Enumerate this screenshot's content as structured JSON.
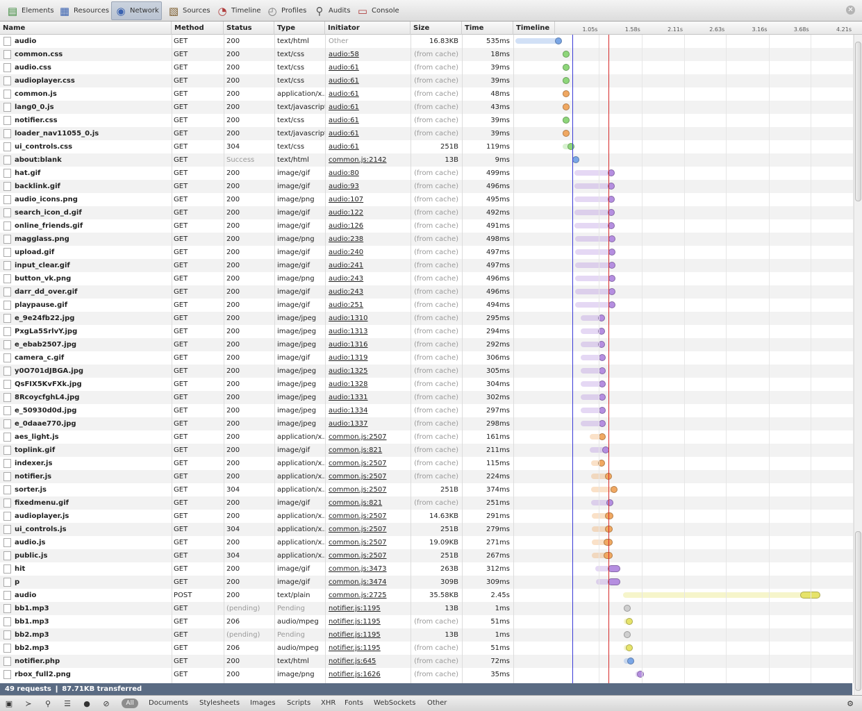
{
  "toolbar": {
    "tabs": [
      {
        "label": "Elements",
        "icon": "elements-icon"
      },
      {
        "label": "Resources",
        "icon": "resources-icon"
      },
      {
        "label": "Network",
        "icon": "network-icon",
        "selected": true
      },
      {
        "label": "Sources",
        "icon": "sources-icon"
      },
      {
        "label": "Timeline",
        "icon": "timeline-icon"
      },
      {
        "label": "Profiles",
        "icon": "profiles-icon"
      },
      {
        "label": "Audits",
        "icon": "audits-icon"
      },
      {
        "label": "Console",
        "icon": "console-icon"
      }
    ]
  },
  "columns": {
    "name": "Name",
    "method": "Method",
    "status": "Status",
    "type": "Type",
    "initiator": "Initiator",
    "size": "Size",
    "time": "Time",
    "timeline": "Timeline"
  },
  "timeline_ticks": [
    "1.05s",
    "1.58s",
    "2.11s",
    "2.63s",
    "3.16s",
    "3.68s",
    "4.21s"
  ],
  "timeline_scale_s": [
    0,
    4.21
  ],
  "markers": {
    "dom_content_loaded_s": 0.72,
    "load_s": 1.17,
    "dom_color": "#3a3ad6",
    "load_color": "#d62a2a"
  },
  "colors": {
    "html": "#7aa6e6",
    "css": "#8ed67a",
    "script": "#f0a862",
    "image": "#b58ee0",
    "other": "#e6e36a",
    "pending": "#cfcfcf"
  },
  "requests": [
    {
      "name": "audio",
      "method": "GET",
      "status": "200",
      "type": "text/html",
      "initiator": "Other",
      "size": "16.83KB",
      "time": "535ms",
      "kind": "html",
      "start": 0.01,
      "wait": 0.5,
      "end": 0.58
    },
    {
      "name": "common.css",
      "method": "GET",
      "status": "200",
      "type": "text/css",
      "initiator": "audio:58",
      "size": "(from cache)",
      "time": "18ms",
      "kind": "css",
      "start": 0.6,
      "wait": 0.6,
      "end": 0.63
    },
    {
      "name": "audio.css",
      "method": "GET",
      "status": "200",
      "type": "text/css",
      "initiator": "audio:61",
      "size": "(from cache)",
      "time": "39ms",
      "kind": "css",
      "start": 0.6,
      "wait": 0.6,
      "end": 0.64
    },
    {
      "name": "audioplayer.css",
      "method": "GET",
      "status": "200",
      "type": "text/css",
      "initiator": "audio:61",
      "size": "(from cache)",
      "time": "39ms",
      "kind": "css",
      "start": 0.6,
      "wait": 0.6,
      "end": 0.64
    },
    {
      "name": "common.js",
      "method": "GET",
      "status": "200",
      "type": "application/x...",
      "initiator": "audio:61",
      "size": "(from cache)",
      "time": "48ms",
      "kind": "script",
      "start": 0.6,
      "wait": 0.6,
      "end": 0.64
    },
    {
      "name": "lang0_0.js",
      "method": "GET",
      "status": "200",
      "type": "text/javascript",
      "initiator": "audio:61",
      "size": "(from cache)",
      "time": "43ms",
      "kind": "script",
      "start": 0.6,
      "wait": 0.6,
      "end": 0.64
    },
    {
      "name": "notifier.css",
      "method": "GET",
      "status": "200",
      "type": "text/css",
      "initiator": "audio:61",
      "size": "(from cache)",
      "time": "39ms",
      "kind": "css",
      "start": 0.6,
      "wait": 0.6,
      "end": 0.64
    },
    {
      "name": "loader_nav11055_0.js",
      "method": "GET",
      "status": "200",
      "type": "text/javascript",
      "initiator": "audio:61",
      "size": "(from cache)",
      "time": "39ms",
      "kind": "script",
      "start": 0.6,
      "wait": 0.6,
      "end": 0.64
    },
    {
      "name": "ui_controls.css",
      "method": "GET",
      "status": "304",
      "type": "text/css",
      "initiator": "audio:61",
      "size": "251B",
      "time": "119ms",
      "kind": "css",
      "start": 0.6,
      "wait": 0.66,
      "end": 0.7
    },
    {
      "name": "about:blank",
      "method": "GET",
      "status": "Success",
      "type": "text/html",
      "initiator": "common.js:2142",
      "size": "13B",
      "time": "9ms",
      "kind": "html",
      "start": 0.72,
      "wait": 0.72,
      "end": 0.74
    },
    {
      "name": "hat.gif",
      "method": "GET",
      "status": "200",
      "type": "image/gif",
      "initiator": "audio:80",
      "size": "(from cache)",
      "time": "499ms",
      "kind": "image",
      "start": 0.74,
      "wait": 1.16,
      "end": 1.21
    },
    {
      "name": "backlink.gif",
      "method": "GET",
      "status": "200",
      "type": "image/gif",
      "initiator": "audio:93",
      "size": "(from cache)",
      "time": "496ms",
      "kind": "image",
      "start": 0.74,
      "wait": 1.16,
      "end": 1.21
    },
    {
      "name": "audio_icons.png",
      "method": "GET",
      "status": "200",
      "type": "image/png",
      "initiator": "audio:107",
      "size": "(from cache)",
      "time": "495ms",
      "kind": "image",
      "start": 0.74,
      "wait": 1.16,
      "end": 1.21
    },
    {
      "name": "search_icon_d.gif",
      "method": "GET",
      "status": "200",
      "type": "image/gif",
      "initiator": "audio:122",
      "size": "(from cache)",
      "time": "492ms",
      "kind": "image",
      "start": 0.74,
      "wait": 1.16,
      "end": 1.21
    },
    {
      "name": "online_friends.gif",
      "method": "GET",
      "status": "200",
      "type": "image/gif",
      "initiator": "audio:126",
      "size": "(from cache)",
      "time": "491ms",
      "kind": "image",
      "start": 0.74,
      "wait": 1.16,
      "end": 1.21
    },
    {
      "name": "magglass.png",
      "method": "GET",
      "status": "200",
      "type": "image/png",
      "initiator": "audio:238",
      "size": "(from cache)",
      "time": "498ms",
      "kind": "image",
      "start": 0.75,
      "wait": 1.17,
      "end": 1.22
    },
    {
      "name": "upload.gif",
      "method": "GET",
      "status": "200",
      "type": "image/gif",
      "initiator": "audio:240",
      "size": "(from cache)",
      "time": "497ms",
      "kind": "image",
      "start": 0.75,
      "wait": 1.17,
      "end": 1.22
    },
    {
      "name": "input_clear.gif",
      "method": "GET",
      "status": "200",
      "type": "image/gif",
      "initiator": "audio:241",
      "size": "(from cache)",
      "time": "497ms",
      "kind": "image",
      "start": 0.75,
      "wait": 1.17,
      "end": 1.22
    },
    {
      "name": "button_vk.png",
      "method": "GET",
      "status": "200",
      "type": "image/png",
      "initiator": "audio:243",
      "size": "(from cache)",
      "time": "496ms",
      "kind": "image",
      "start": 0.75,
      "wait": 1.17,
      "end": 1.22
    },
    {
      "name": "darr_dd_over.gif",
      "method": "GET",
      "status": "200",
      "type": "image/gif",
      "initiator": "audio:243",
      "size": "(from cache)",
      "time": "496ms",
      "kind": "image",
      "start": 0.75,
      "wait": 1.17,
      "end": 1.22
    },
    {
      "name": "playpause.gif",
      "method": "GET",
      "status": "200",
      "type": "image/gif",
      "initiator": "audio:251",
      "size": "(from cache)",
      "time": "494ms",
      "kind": "image",
      "start": 0.75,
      "wait": 1.17,
      "end": 1.22
    },
    {
      "name": "e_9e24fb22.jpg",
      "method": "GET",
      "status": "200",
      "type": "image/jpeg",
      "initiator": "audio:1310",
      "size": "(from cache)",
      "time": "295ms",
      "kind": "image",
      "start": 0.82,
      "wait": 1.04,
      "end": 1.09
    },
    {
      "name": "PxgLa5SrlvY.jpg",
      "method": "GET",
      "status": "200",
      "type": "image/jpeg",
      "initiator": "audio:1313",
      "size": "(from cache)",
      "time": "294ms",
      "kind": "image",
      "start": 0.82,
      "wait": 1.04,
      "end": 1.09
    },
    {
      "name": "e_ebab2507.jpg",
      "method": "GET",
      "status": "200",
      "type": "image/jpeg",
      "initiator": "audio:1316",
      "size": "(from cache)",
      "time": "292ms",
      "kind": "image",
      "start": 0.82,
      "wait": 1.04,
      "end": 1.09
    },
    {
      "name": "camera_c.gif",
      "method": "GET",
      "status": "200",
      "type": "image/gif",
      "initiator": "audio:1319",
      "size": "(from cache)",
      "time": "306ms",
      "kind": "image",
      "start": 0.82,
      "wait": 1.05,
      "end": 1.1
    },
    {
      "name": "y0O701dJBGA.jpg",
      "method": "GET",
      "status": "200",
      "type": "image/jpeg",
      "initiator": "audio:1325",
      "size": "(from cache)",
      "time": "305ms",
      "kind": "image",
      "start": 0.82,
      "wait": 1.05,
      "end": 1.1
    },
    {
      "name": "QsFIX5KvFXk.jpg",
      "method": "GET",
      "status": "200",
      "type": "image/jpeg",
      "initiator": "audio:1328",
      "size": "(from cache)",
      "time": "304ms",
      "kind": "image",
      "start": 0.82,
      "wait": 1.05,
      "end": 1.1
    },
    {
      "name": "8RcoycfghL4.jpg",
      "method": "GET",
      "status": "200",
      "type": "image/jpeg",
      "initiator": "audio:1331",
      "size": "(from cache)",
      "time": "302ms",
      "kind": "image",
      "start": 0.82,
      "wait": 1.05,
      "end": 1.1
    },
    {
      "name": "e_50930d0d.jpg",
      "method": "GET",
      "status": "200",
      "type": "image/jpeg",
      "initiator": "audio:1334",
      "size": "(from cache)",
      "time": "297ms",
      "kind": "image",
      "start": 0.82,
      "wait": 1.05,
      "end": 1.1
    },
    {
      "name": "e_0daae770.jpg",
      "method": "GET",
      "status": "200",
      "type": "image/jpeg",
      "initiator": "audio:1337",
      "size": "(from cache)",
      "time": "298ms",
      "kind": "image",
      "start": 0.82,
      "wait": 1.05,
      "end": 1.1
    },
    {
      "name": "aes_light.js",
      "method": "GET",
      "status": "200",
      "type": "application/x...",
      "initiator": "common.js:2507",
      "size": "(from cache)",
      "time": "161ms",
      "kind": "script",
      "start": 0.93,
      "wait": 1.05,
      "end": 1.09
    },
    {
      "name": "toplink.gif",
      "method": "GET",
      "status": "200",
      "type": "image/gif",
      "initiator": "common.js:821",
      "size": "(from cache)",
      "time": "211ms",
      "kind": "image",
      "start": 0.93,
      "wait": 1.09,
      "end": 1.14
    },
    {
      "name": "indexer.js",
      "method": "GET",
      "status": "200",
      "type": "application/x...",
      "initiator": "common.js:2507",
      "size": "(from cache)",
      "time": "115ms",
      "kind": "script",
      "start": 0.95,
      "wait": 1.04,
      "end": 1.08
    },
    {
      "name": "notifier.js",
      "method": "GET",
      "status": "200",
      "type": "application/x...",
      "initiator": "common.js:2507",
      "size": "(from cache)",
      "time": "224ms",
      "kind": "script",
      "start": 0.95,
      "wait": 1.12,
      "end": 1.17
    },
    {
      "name": "sorter.js",
      "method": "GET",
      "status": "304",
      "type": "application/x...",
      "initiator": "common.js:2507",
      "size": "251B",
      "time": "374ms",
      "kind": "script",
      "start": 0.95,
      "wait": 1.19,
      "end": 1.27
    },
    {
      "name": "fixedmenu.gif",
      "method": "GET",
      "status": "200",
      "type": "image/gif",
      "initiator": "common.js:821",
      "size": "(from cache)",
      "time": "251ms",
      "kind": "image",
      "start": 0.95,
      "wait": 1.14,
      "end": 1.18
    },
    {
      "name": "audioplayer.js",
      "method": "GET",
      "status": "200",
      "type": "application/x...",
      "initiator": "common.js:2507",
      "size": "14.63KB",
      "time": "291ms",
      "kind": "script",
      "start": 0.96,
      "wait": 1.12,
      "end": 1.23
    },
    {
      "name": "ui_controls.js",
      "method": "GET",
      "status": "304",
      "type": "application/x...",
      "initiator": "common.js:2507",
      "size": "251B",
      "time": "279ms",
      "kind": "script",
      "start": 0.96,
      "wait": 1.12,
      "end": 1.22
    },
    {
      "name": "audio.js",
      "method": "GET",
      "status": "200",
      "type": "application/x...",
      "initiator": "common.js:2507",
      "size": "19.09KB",
      "time": "271ms",
      "kind": "script",
      "start": 0.96,
      "wait": 1.11,
      "end": 1.22
    },
    {
      "name": "public.js",
      "method": "GET",
      "status": "304",
      "type": "application/x...",
      "initiator": "common.js:2507",
      "size": "251B",
      "time": "267ms",
      "kind": "script",
      "start": 0.96,
      "wait": 1.11,
      "end": 1.22
    },
    {
      "name": "hit",
      "method": "GET",
      "status": "200",
      "type": "image/gif",
      "initiator": "common.js:3473",
      "size": "263B",
      "time": "312ms",
      "kind": "image",
      "start": 1.0,
      "wait": 1.16,
      "end": 1.31
    },
    {
      "name": "p",
      "method": "GET",
      "status": "200",
      "type": "image/gif",
      "initiator": "common.js:3474",
      "size": "309B",
      "time": "309ms",
      "kind": "image",
      "start": 1.01,
      "wait": 1.16,
      "end": 1.31
    },
    {
      "name": "audio",
      "method": "POST",
      "status": "200",
      "type": "text/plain",
      "initiator": "common.js:2725",
      "size": "35.58KB",
      "time": "2.45s",
      "kind": "other",
      "start": 1.35,
      "wait": 3.55,
      "end": 3.8
    },
    {
      "name": "bb1.mp3",
      "method": "GET",
      "status": "(pending)",
      "type": "Pending",
      "initiator": "notifier.js:1195",
      "size": "13B",
      "time": "1ms",
      "kind": "pending",
      "start": 1.36,
      "wait": 1.36,
      "end": 1.38
    },
    {
      "name": "bb1.mp3",
      "method": "GET",
      "status": "206",
      "type": "audio/mpeg",
      "initiator": "notifier.js:1195",
      "size": "(from cache)",
      "time": "51ms",
      "kind": "other",
      "start": 1.36,
      "wait": 1.38,
      "end": 1.42
    },
    {
      "name": "bb2.mp3",
      "method": "GET",
      "status": "(pending)",
      "type": "Pending",
      "initiator": "notifier.js:1195",
      "size": "13B",
      "time": "1ms",
      "kind": "pending",
      "start": 1.36,
      "wait": 1.36,
      "end": 1.38
    },
    {
      "name": "bb2.mp3",
      "method": "GET",
      "status": "206",
      "type": "audio/mpeg",
      "initiator": "notifier.js:1195",
      "size": "(from cache)",
      "time": "51ms",
      "kind": "other",
      "start": 1.36,
      "wait": 1.38,
      "end": 1.42
    },
    {
      "name": "notifier.php",
      "method": "GET",
      "status": "200",
      "type": "text/html",
      "initiator": "notifier.js:645",
      "size": "(from cache)",
      "time": "72ms",
      "kind": "html",
      "start": 1.36,
      "wait": 1.4,
      "end": 1.44
    },
    {
      "name": "rbox_full2.png",
      "method": "GET",
      "status": "200",
      "type": "image/png",
      "initiator": "notifier.js:1626",
      "size": "(from cache)",
      "time": "35ms",
      "kind": "image",
      "start": 1.5,
      "wait": 1.52,
      "end": 1.55
    }
  ],
  "summary": {
    "text": "49 requests  ❙  87.71KB transferred"
  },
  "filters": {
    "all": "All",
    "items": [
      "Documents",
      "Stylesheets",
      "Images",
      "Scripts",
      "XHR",
      "Fonts",
      "WebSockets",
      "Other"
    ]
  }
}
